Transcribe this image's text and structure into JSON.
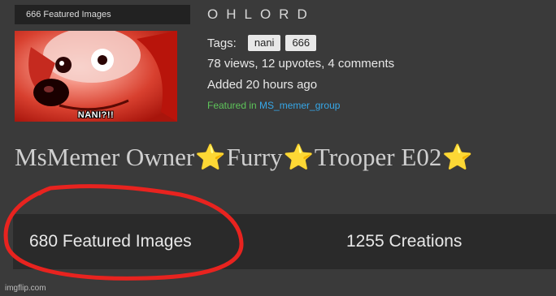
{
  "thumbnail": {
    "header": "666 Featured Images",
    "caption": "NANI?!!"
  },
  "post": {
    "title": "OHLORD",
    "tags_label": "Tags:",
    "tags": [
      "nani",
      "666"
    ],
    "stats": "78 views, 12 upvotes, 4 comments",
    "added": "Added 20 hours ago",
    "featured_prefix": "Featured in",
    "featured_stream": "MS_memer_group"
  },
  "profile": {
    "name_parts": [
      "MsMemer Owner",
      "Furry",
      "Trooper E02"
    ],
    "star_glyph": "⭐",
    "featured_images": "680 Featured Images",
    "creations": "1255 Creations"
  },
  "annotation": {
    "color": "#e8231f"
  },
  "watermark": "imgflip.com"
}
